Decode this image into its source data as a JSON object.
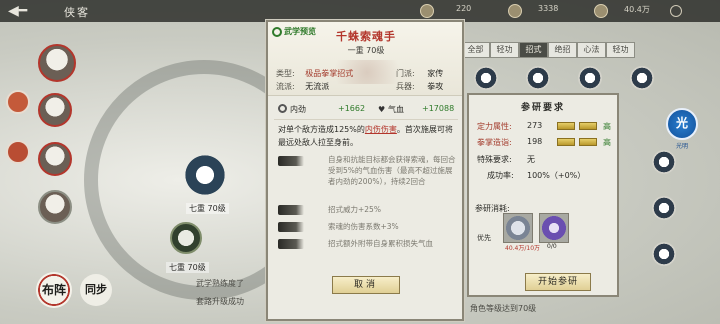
{
  "topbar": {
    "back_symbol": "◀━",
    "title": "侠客",
    "res1": "220",
    "res2": "3338",
    "res3": "40.4万"
  },
  "left_chars": [
    {
      "label": ""
    },
    {
      "label": ""
    },
    {
      "label": ""
    },
    {
      "label": ""
    },
    {
      "label": ""
    }
  ],
  "scene": {
    "label_a": "七重 70级",
    "label_b": "七重 70级",
    "bottom_a": "武学熟练度了",
    "bottom_b": "角色等级达到70级",
    "bottom_c": "套路升级成功"
  },
  "right_tabs": [
    "全部",
    "轻功",
    "招式",
    "绝招",
    "心法",
    "轻功"
  ],
  "bottom_buttons": {
    "btn_a": "布阵",
    "btn_b": "同步"
  },
  "panel": {
    "header_tag": "武学预览",
    "skill_name": "千蛛索魂手",
    "level": "一重 70级",
    "type_label": "类型:",
    "type_value": "极品拳掌招式",
    "school_label": "流派:",
    "school_value": "无流派",
    "sect_label": "门派:",
    "sect_value": "家传",
    "weapon_label": "兵器:",
    "weapon_value": "拳攻",
    "stat1_label": "内劲",
    "stat1_value": "+1662",
    "stat2_label": "气血",
    "stat2_value": "+17088",
    "desc_prefix": "对单个敌方造成125%的",
    "desc_link": "内伤伤害",
    "desc_suffix": "。首次施展可将最远处敌人拉至身前。",
    "effects": [
      {
        "text": "自身和抗能目标都会获得索魂，每回合受到5%的气血伤害（最高不超过施展者内劲的200%），持续2回合"
      },
      {
        "text": "招式威力+25%"
      },
      {
        "text": "索魂的伤害系数+3%"
      },
      {
        "text": "招式额外附带自身累积损失气血"
      }
    ],
    "cancel_label": "取消"
  },
  "rpanel": {
    "title": "参研要求",
    "row1_label": "定力属性:",
    "row1_value": "273",
    "row1_grade": "高",
    "row2_label": "拳掌造诣:",
    "row2_value": "198",
    "row2_grade": "高",
    "row3_label": "特殊要求:",
    "row3_value": "无",
    "row4_label": "成功率:",
    "row4_value": "100%（+0%）",
    "consume_label": "参研消耗:",
    "item_prefix": "优先",
    "item1_count": "40.4万/10万",
    "item2_count": "0/0",
    "start_label": "开始参研"
  },
  "side_button": {
    "label": "光",
    "caption": "光明"
  }
}
